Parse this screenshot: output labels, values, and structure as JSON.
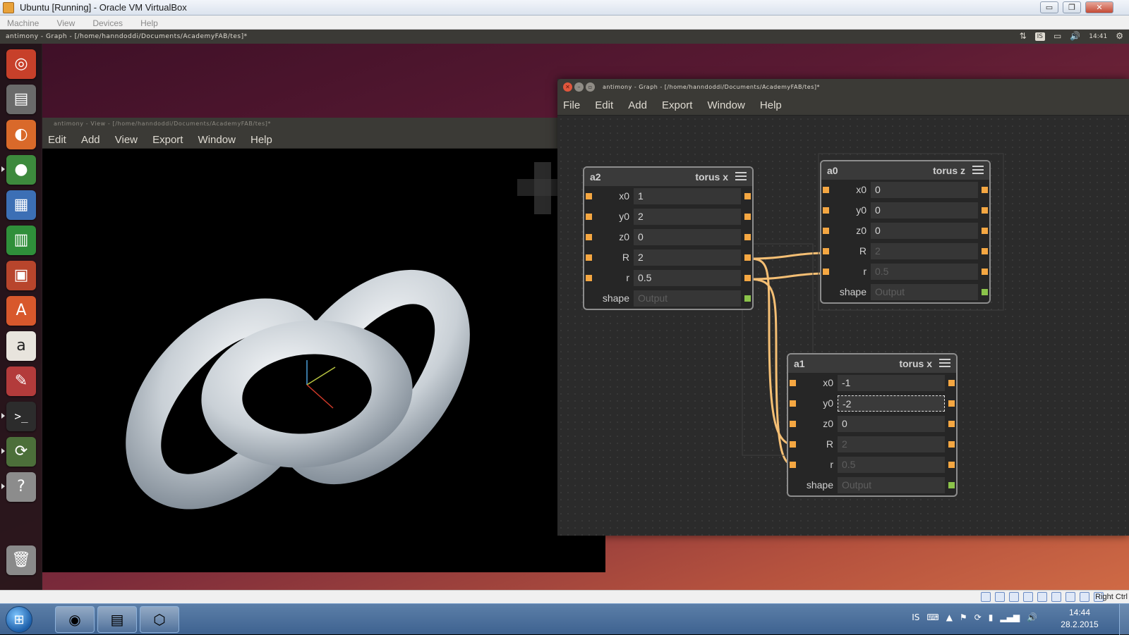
{
  "host": {
    "title": "Ubuntu [Running] - Oracle VM VirtualBox",
    "menu": [
      "Machine",
      "View",
      "Devices",
      "Help"
    ],
    "host_key": "Right Ctrl",
    "window_controls": {
      "minimize": "▭",
      "restore": "❐",
      "close": "✕"
    }
  },
  "ubuntu_panel": {
    "active_title": "antimony - Graph - [/home/hanndoddi/Documents/AcademyFAB/tes]*",
    "time": "14:41",
    "tray_icons": [
      "network-icon",
      "keyboard-layout-indicator",
      "battery-icon",
      "volume-icon",
      "gear-icon"
    ],
    "keyboard_layout": "IS"
  },
  "launcher": {
    "items": [
      "ubuntu-dash-icon",
      "files-icon",
      "firefox-icon",
      "chrome-icon",
      "writer-icon",
      "calc-icon",
      "impress-icon",
      "software-center-icon",
      "amazon-icon",
      "system-settings-icon",
      "terminal-icon",
      "software-updater-icon",
      "help-icon",
      "trash-icon"
    ]
  },
  "view_window": {
    "title": "antimony - View - [/home/hanndoddi/Documents/AcademyFAB/tes]*",
    "menu": [
      "Edit",
      "Add",
      "View",
      "Export",
      "Window",
      "Help"
    ]
  },
  "graph_window": {
    "title": "antimony - Graph - [/home/hanndoddi/Documents/AcademyFAB/tes]*",
    "menu": [
      "File",
      "Edit",
      "Add",
      "Export",
      "Window",
      "Help"
    ],
    "nodes": [
      {
        "name": "a2",
        "type": "torus x",
        "rows": [
          {
            "label": "x0",
            "value": "1"
          },
          {
            "label": "y0",
            "value": "2"
          },
          {
            "label": "z0",
            "value": "0"
          },
          {
            "label": "R",
            "value": "2"
          },
          {
            "label": "r",
            "value": "0.5"
          },
          {
            "label": "shape",
            "value": "Output"
          }
        ]
      },
      {
        "name": "a0",
        "type": "torus z",
        "rows": [
          {
            "label": "x0",
            "value": "0"
          },
          {
            "label": "y0",
            "value": "0"
          },
          {
            "label": "z0",
            "value": "0"
          },
          {
            "label": "R",
            "value": "2"
          },
          {
            "label": "r",
            "value": "0.5"
          },
          {
            "label": "shape",
            "value": "Output"
          }
        ]
      },
      {
        "name": "a1",
        "type": "torus x",
        "rows": [
          {
            "label": "x0",
            "value": "-1"
          },
          {
            "label": "y0",
            "value": "-2"
          },
          {
            "label": "z0",
            "value": "0"
          },
          {
            "label": "R",
            "value": "2"
          },
          {
            "label": "r",
            "value": "0.5"
          },
          {
            "label": "shape",
            "value": "Output"
          }
        ]
      }
    ],
    "colors": {
      "port": "#f5a742",
      "output_port": "#8bc34a",
      "wire": "#f5bf74"
    }
  },
  "taskbar": {
    "buttons": [
      "chrome-icon",
      "explorer-icon",
      "virtualbox-icon"
    ],
    "language": "IS",
    "time": "14:44",
    "date": "28.2.2015"
  }
}
